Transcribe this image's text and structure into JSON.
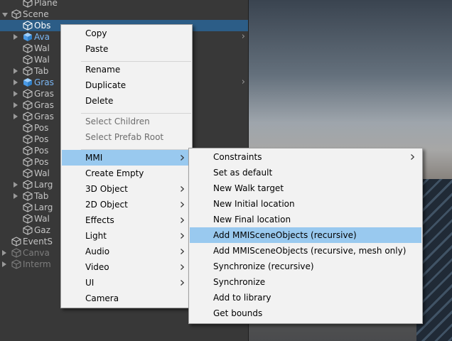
{
  "hierarchy": {
    "rows": [
      {
        "label": "Plane",
        "depth": 1,
        "fold": "none",
        "state": "normal"
      },
      {
        "label": "Scene",
        "depth": 0,
        "fold": "open",
        "state": "normal"
      },
      {
        "label": "Obs",
        "depth": 1,
        "fold": "none",
        "state": "selected"
      },
      {
        "label": "Ava",
        "depth": 1,
        "fold": "closed",
        "state": "prefab",
        "children_arrow": true
      },
      {
        "label": "Wal",
        "depth": 1,
        "fold": "none",
        "state": "normal"
      },
      {
        "label": "Wal",
        "depth": 1,
        "fold": "none",
        "state": "normal"
      },
      {
        "label": "Tab",
        "depth": 1,
        "fold": "closed",
        "state": "normal"
      },
      {
        "label": "Gras",
        "depth": 1,
        "fold": "closed",
        "state": "prefab",
        "children_arrow": true
      },
      {
        "label": "Gras",
        "depth": 1,
        "fold": "closed",
        "state": "normal"
      },
      {
        "label": "Gras",
        "depth": 1,
        "fold": "closed",
        "state": "normal"
      },
      {
        "label": "Gras",
        "depth": 1,
        "fold": "closed",
        "state": "normal"
      },
      {
        "label": "Pos",
        "depth": 1,
        "fold": "none",
        "state": "normal"
      },
      {
        "label": "Pos",
        "depth": 1,
        "fold": "none",
        "state": "normal"
      },
      {
        "label": "Pos",
        "depth": 1,
        "fold": "none",
        "state": "normal"
      },
      {
        "label": "Pos",
        "depth": 1,
        "fold": "none",
        "state": "normal"
      },
      {
        "label": "Wal",
        "depth": 1,
        "fold": "none",
        "state": "normal"
      },
      {
        "label": "Larg",
        "depth": 1,
        "fold": "closed",
        "state": "normal"
      },
      {
        "label": "Tab",
        "depth": 1,
        "fold": "closed",
        "state": "normal"
      },
      {
        "label": "Larg",
        "depth": 1,
        "fold": "none",
        "state": "normal"
      },
      {
        "label": "Wal",
        "depth": 1,
        "fold": "none",
        "state": "normal"
      },
      {
        "label": "Gaz",
        "depth": 1,
        "fold": "none",
        "state": "normal"
      },
      {
        "label": "EventS",
        "depth": 0,
        "fold": "none",
        "state": "normal"
      },
      {
        "label": "Canva",
        "depth": 0,
        "fold": "closed",
        "state": "disabled"
      },
      {
        "label": "Interm",
        "depth": 0,
        "fold": "closed",
        "state": "disabled"
      }
    ]
  },
  "context_menu": {
    "items": [
      {
        "label": "Copy",
        "state": "normal",
        "submenu": false
      },
      {
        "label": "Paste",
        "state": "normal",
        "submenu": false
      },
      {
        "separator": true
      },
      {
        "label": "Rename",
        "state": "normal",
        "submenu": false
      },
      {
        "label": "Duplicate",
        "state": "normal",
        "submenu": false
      },
      {
        "label": "Delete",
        "state": "normal",
        "submenu": false
      },
      {
        "separator": true
      },
      {
        "label": "Select Children",
        "state": "disabled",
        "submenu": false
      },
      {
        "label": "Select Prefab Root",
        "state": "disabled",
        "submenu": false
      },
      {
        "separator": true
      },
      {
        "label": "MMI",
        "state": "highlight",
        "submenu": true
      },
      {
        "label": "Create Empty",
        "state": "normal",
        "submenu": false
      },
      {
        "label": "3D Object",
        "state": "normal",
        "submenu": true
      },
      {
        "label": "2D Object",
        "state": "normal",
        "submenu": true
      },
      {
        "label": "Effects",
        "state": "normal",
        "submenu": true
      },
      {
        "label": "Light",
        "state": "normal",
        "submenu": true
      },
      {
        "label": "Audio",
        "state": "normal",
        "submenu": true
      },
      {
        "label": "Video",
        "state": "normal",
        "submenu": true
      },
      {
        "label": "UI",
        "state": "normal",
        "submenu": true
      },
      {
        "label": "Camera",
        "state": "normal",
        "submenu": false
      }
    ]
  },
  "mmi_submenu": {
    "items": [
      {
        "label": "Constraints",
        "state": "normal",
        "submenu": true
      },
      {
        "label": "Set as default",
        "state": "normal",
        "submenu": false
      },
      {
        "label": "New Walk target",
        "state": "normal",
        "submenu": false
      },
      {
        "label": "New Initial location",
        "state": "normal",
        "submenu": false
      },
      {
        "label": "New Final location",
        "state": "normal",
        "submenu": false
      },
      {
        "label": "Add MMISceneObjects (recursive)",
        "state": "highlight",
        "submenu": false
      },
      {
        "label": "Add MMISceneObjects (recursive, mesh only)",
        "state": "normal",
        "submenu": false
      },
      {
        "label": "Synchronize (recursive)",
        "state": "normal",
        "submenu": false
      },
      {
        "label": "Synchronize",
        "state": "normal",
        "submenu": false
      },
      {
        "label": "Add to library",
        "state": "normal",
        "submenu": false
      },
      {
        "label": "Get bounds",
        "state": "normal",
        "submenu": false
      }
    ]
  },
  "icons": {
    "gameobject": "cube-outline-icon",
    "prefab": "cube-filled-icon",
    "submenu_arrow": "chevron-right-icon",
    "foldout_open": "triangle-down-icon",
    "foldout_closed": "triangle-right-icon"
  },
  "colors": {
    "selection": "#2c5d87",
    "prefab_text": "#7bb7f4",
    "menu_highlight": "#99c9ef",
    "menu_bg": "#f2f2f2"
  }
}
